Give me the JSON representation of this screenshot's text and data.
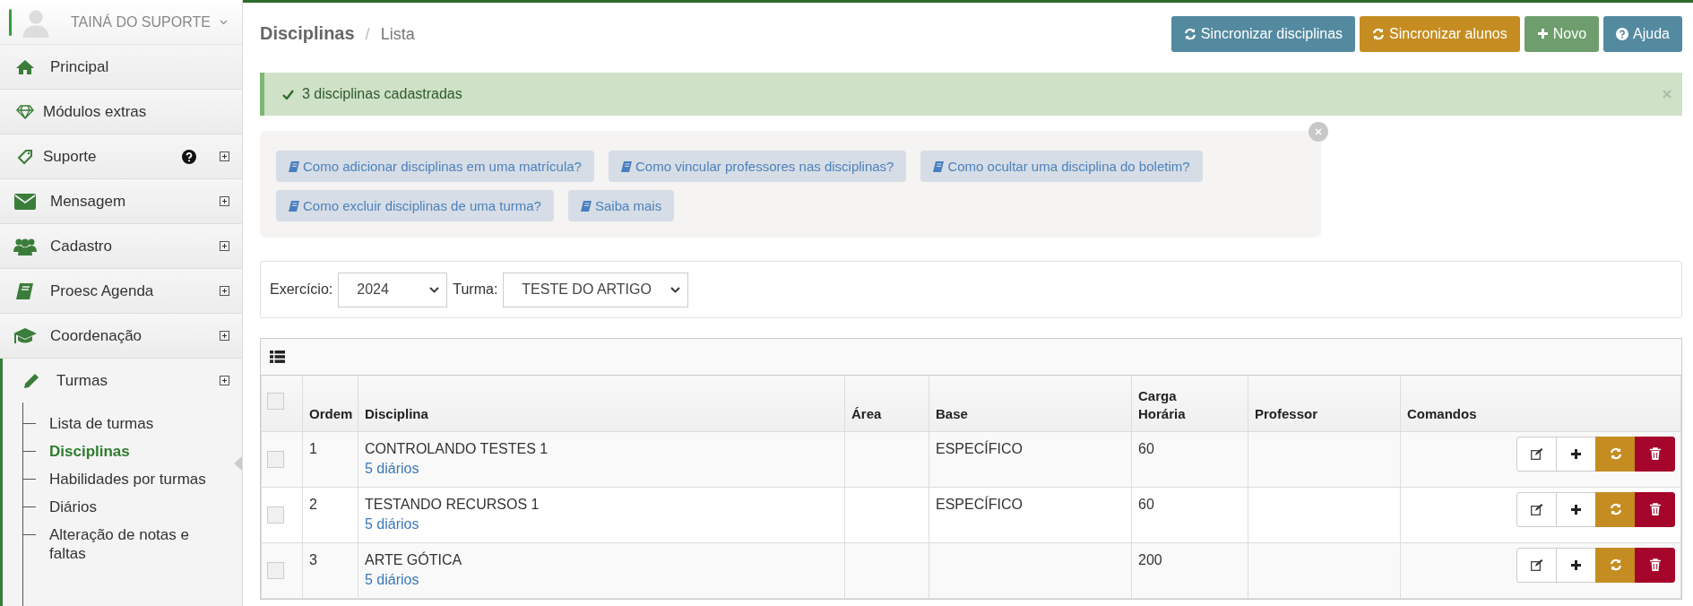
{
  "user": {
    "name": "TAINÁ DO SUPORTE"
  },
  "sidebar": {
    "items": [
      {
        "label": "Principal",
        "expandable": false,
        "help": false,
        "expanded": false
      },
      {
        "label": "Módulos extras",
        "expandable": false,
        "help": false,
        "expanded": false
      },
      {
        "label": "Suporte",
        "expandable": true,
        "help": true,
        "expanded": false
      },
      {
        "label": "Mensagem",
        "expandable": true,
        "help": false,
        "expanded": false
      },
      {
        "label": "Cadastro",
        "expandable": true,
        "help": false,
        "expanded": false
      },
      {
        "label": "Proesc Agenda",
        "expandable": true,
        "help": false,
        "expanded": false
      },
      {
        "label": "Coordenação",
        "expandable": true,
        "help": false,
        "expanded": false
      },
      {
        "label": "Turmas",
        "expandable": true,
        "help": false,
        "expanded": true,
        "children": [
          {
            "label": "Lista de turmas",
            "selected": false
          },
          {
            "label": "Disciplinas",
            "selected": true
          },
          {
            "label": "Habilidades por turmas",
            "selected": false
          },
          {
            "label": "Diários",
            "selected": false
          },
          {
            "label": "Alteração de notas e faltas",
            "selected": false
          }
        ]
      }
    ]
  },
  "breadcrumb": {
    "title": "Disciplinas",
    "separator": "/",
    "current": "Lista"
  },
  "actions": [
    {
      "label": "Sincronizar disciplinas",
      "kind": "sync",
      "color": "#548aa0"
    },
    {
      "label": "Sincronizar alunos",
      "kind": "sync",
      "color": "#c58d21"
    },
    {
      "label": "Novo",
      "kind": "add",
      "color": "#6e9e6e"
    },
    {
      "label": "Ajuda",
      "kind": "help",
      "color": "#548aa0"
    }
  ],
  "alert": {
    "message": "3 disciplinas cadastradas"
  },
  "help_links": [
    "Como adicionar disciplinas em uma matrícula?",
    "Como vincular professores nas disciplinas?",
    "Como ocultar uma disciplina do boletim?",
    "Como excluir disciplinas de uma turma?",
    "Saiba mais"
  ],
  "filters": [
    {
      "label": "Exercício:",
      "value": "2024"
    },
    {
      "label": "Turma:",
      "value": "TESTE DO ARTIGO"
    }
  ],
  "table": {
    "select_all_checked": false,
    "columns": [
      "Ordem",
      "Disciplina",
      "Área",
      "Base",
      "Carga Horária",
      "Professor",
      "Comandos"
    ],
    "rows": [
      {
        "checked": false,
        "ordem": "1",
        "disciplina": "CONTROLANDO TESTES 1",
        "diarios": "5 diários",
        "base": "ESPECÍFICO",
        "carga": "60"
      },
      {
        "checked": false,
        "ordem": "2",
        "disciplina": "TESTANDO RECURSOS 1",
        "diarios": "5 diários",
        "base": "ESPECÍFICO",
        "carga": "60"
      },
      {
        "checked": false,
        "ordem": "3",
        "disciplina": "ARTE GÓTICA",
        "diarios": "5 diários",
        "carga": "200"
      }
    ]
  }
}
